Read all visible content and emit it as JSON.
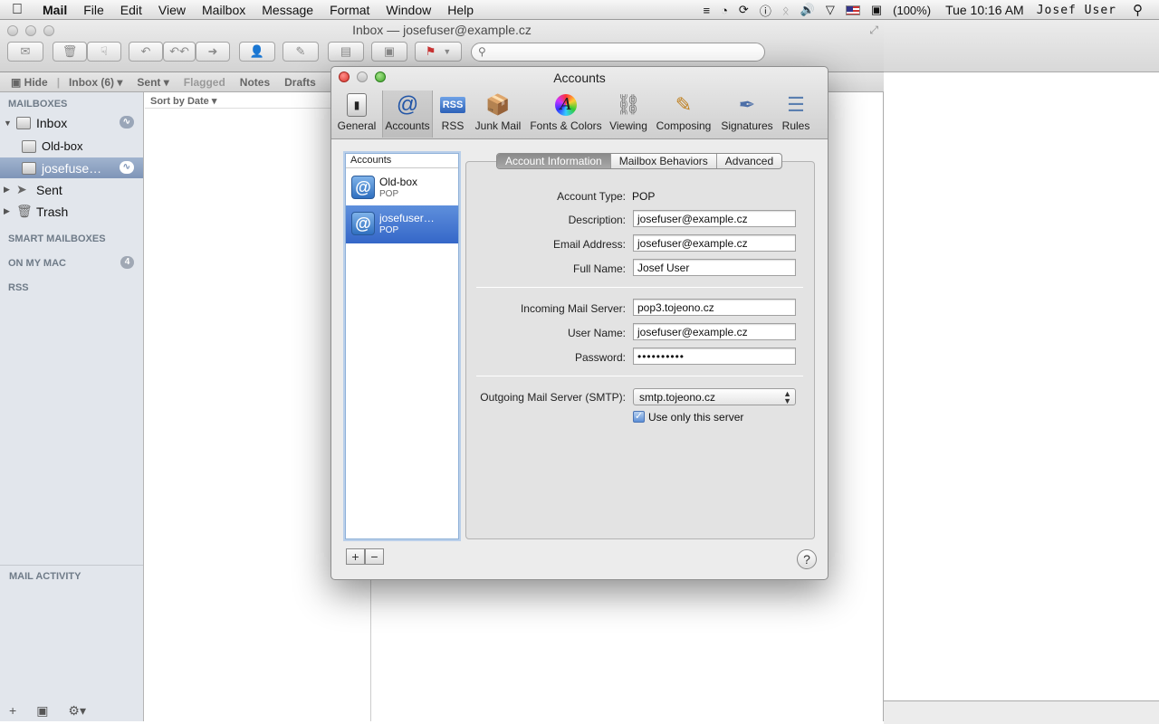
{
  "menubar": {
    "app": "Mail",
    "items": [
      "File",
      "Edit",
      "View",
      "Mailbox",
      "Message",
      "Format",
      "Window",
      "Help"
    ],
    "battery": "(100%)",
    "clock": "Tue 10:16 AM",
    "user": "Josef User"
  },
  "mail_window": {
    "title": "Inbox — josefuser@example.cz",
    "favorites": {
      "hide": "Hide",
      "inbox": "Inbox (6)",
      "sent": "Sent",
      "flagged": "Flagged",
      "notes": "Notes",
      "drafts": "Drafts"
    },
    "sort_label": "Sort by Date"
  },
  "sidebar": {
    "mailboxes_header": "MAILBOXES",
    "inbox": "Inbox",
    "oldbox": "Old-box",
    "josefuser": "josefuse…",
    "sent": "Sent",
    "trash": "Trash",
    "smart_header": "SMART MAILBOXES",
    "onmymac_header": "ON MY MAC",
    "onmymac_count": "4",
    "rss_header": "RSS",
    "activity_header": "MAIL ACTIVITY"
  },
  "prefs": {
    "title": "Accounts",
    "tabs": {
      "general": "General",
      "accounts": "Accounts",
      "rss": "RSS",
      "junk": "Junk Mail",
      "fonts": "Fonts & Colors",
      "viewing": "Viewing",
      "composing": "Composing",
      "signatures": "Signatures",
      "rules": "Rules"
    },
    "list_header": "Accounts",
    "accounts": [
      {
        "name": "Old-box",
        "type": "POP"
      },
      {
        "name": "josefuser…",
        "type": "POP"
      }
    ],
    "segments": {
      "info": "Account Information",
      "behaviors": "Mailbox Behaviors",
      "advanced": "Advanced"
    },
    "fields": {
      "account_type_label": "Account Type:",
      "account_type": "POP",
      "description_label": "Description:",
      "description": "josefuser@example.cz",
      "email_label": "Email Address:",
      "email": "josefuser@example.cz",
      "fullname_label": "Full Name:",
      "fullname": "Josef User",
      "incoming_label": "Incoming Mail Server:",
      "incoming": "pop3.tojeono.cz",
      "username_label": "User Name:",
      "username": "josefuser@example.cz",
      "password_label": "Password:",
      "password": "••••••••••",
      "smtp_label": "Outgoing Mail Server (SMTP):",
      "smtp": "smtp.tojeono.cz",
      "use_only_label": "Use only this server"
    },
    "add": "+",
    "remove": "−",
    "help": "?"
  }
}
